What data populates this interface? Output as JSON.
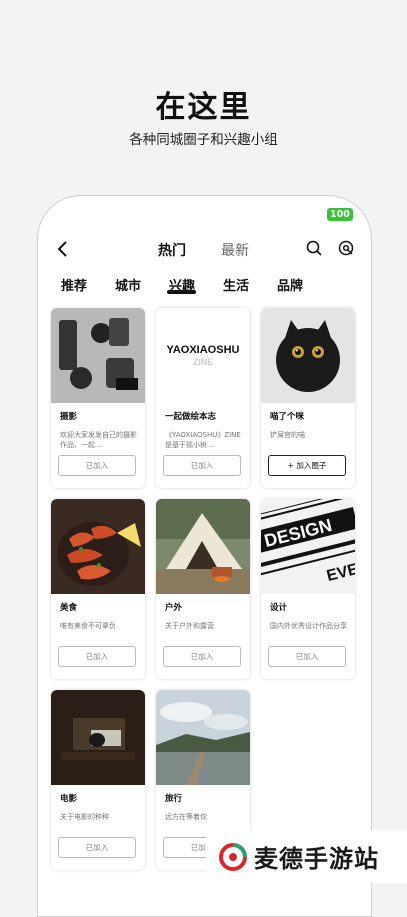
{
  "hero": {
    "title": "在这里",
    "subtitle": "各种同城圈子和兴趣小组"
  },
  "status": {
    "battery": "100"
  },
  "nav": {
    "tab_hot": "热门",
    "tab_new": "最新"
  },
  "categories": [
    "推荐",
    "城市",
    "兴趣",
    "生活",
    "品牌"
  ],
  "cards": [
    {
      "title": "摄影",
      "desc": "欢迎大家发发自己的摄影作品，一起...",
      "button": "已加入"
    },
    {
      "title": "一起做绘本志",
      "desc": "《YAOXIAOSHU》ZINE是基于摇小树...",
      "button": "已加入",
      "image_text": "YAOXIAOSHU",
      "image_subtext": "ZINE"
    },
    {
      "title": "喵了个咪",
      "desc": "铲屎官的喵",
      "button": "+ 加入圈子"
    },
    {
      "title": "美食",
      "desc": "唯有美食不可辜负",
      "button": "已加入"
    },
    {
      "title": "户外",
      "desc": "关于户外和露营",
      "button": "已加入"
    },
    {
      "title": "设计",
      "desc": "国内外优秀设计作品分享",
      "button": "已加入",
      "image_text": "DESIGN",
      "image_subtext": "EVE"
    },
    {
      "title": "电影",
      "desc": "关于电影的种种",
      "button": "已加入"
    },
    {
      "title": "旅行",
      "desc": "远方在等着你",
      "button": "已加入"
    }
  ],
  "watermark": {
    "text": "麦德手游站"
  }
}
